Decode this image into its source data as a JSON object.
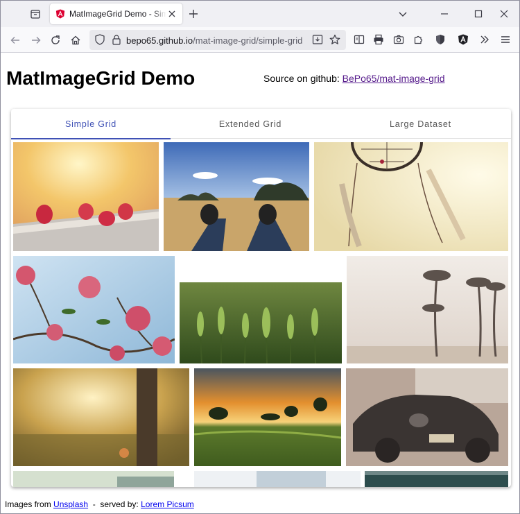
{
  "browser": {
    "tab": {
      "title": "MatImageGrid Demo - Simple Grid"
    },
    "url": {
      "host": "bepo65.github.io",
      "path": "/mat-image-grid/simple-grid"
    }
  },
  "page": {
    "title": "MatImageGrid Demo",
    "source_prefix": "Source on github: ",
    "source_link": "BePo65/mat-image-grid",
    "tabs": [
      {
        "label": "Simple Grid",
        "active": true
      },
      {
        "label": "Extended Grid",
        "active": false
      },
      {
        "label": "Large Dataset",
        "active": false
      }
    ],
    "images": [
      {
        "subject": "raspberries"
      },
      {
        "subject": "sneakers-in-field"
      },
      {
        "subject": "dreamcatcher"
      },
      {
        "subject": "pink-blossoms"
      },
      {
        "subject": "wheat-field"
      },
      {
        "subject": "palm-trees"
      },
      {
        "subject": "sunlit-meadow-tree"
      },
      {
        "subject": "sunset-landscape"
      },
      {
        "subject": "vintage-car"
      },
      {
        "subject": "partial-image-1"
      },
      {
        "subject": "partial-image-2"
      },
      {
        "subject": "partial-image-3"
      }
    ],
    "footer": {
      "prefix": "Images from ",
      "unsplash": "Unsplash",
      "middle": "  -  served by: ",
      "picsum": "Lorem Picsum"
    }
  },
  "colors": {
    "accent": "#3f51b5",
    "link_visited": "#551a8b",
    "link": "#0000ee"
  }
}
